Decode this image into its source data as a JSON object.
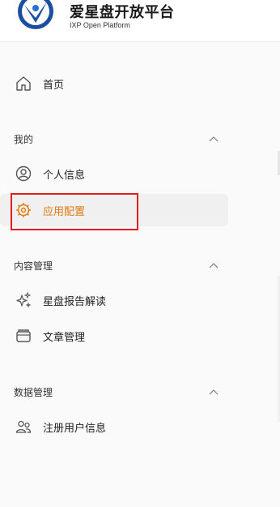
{
  "brand": {
    "title": "爱星盘开放平台",
    "subtitle": "IXP Open Platform"
  },
  "nav": {
    "home": {
      "label": "首页",
      "icon": "home-icon"
    },
    "groups": [
      {
        "label": "我的",
        "items": [
          {
            "label": "个人信息",
            "icon": "user-circle-icon"
          },
          {
            "label": "应用配置",
            "icon": "gear-icon",
            "active": true
          }
        ]
      },
      {
        "label": "内容管理",
        "items": [
          {
            "label": "星盘报告解读",
            "icon": "sparkle-icon"
          },
          {
            "label": "文章管理",
            "icon": "folder-icon"
          }
        ]
      },
      {
        "label": "数据管理",
        "items": [
          {
            "label": "注册用户信息",
            "icon": "users-icon"
          }
        ]
      }
    ]
  },
  "colors": {
    "accent": "#e07a10",
    "highlight": "#e01e1e",
    "logo_blue": "#1a4fa0"
  }
}
